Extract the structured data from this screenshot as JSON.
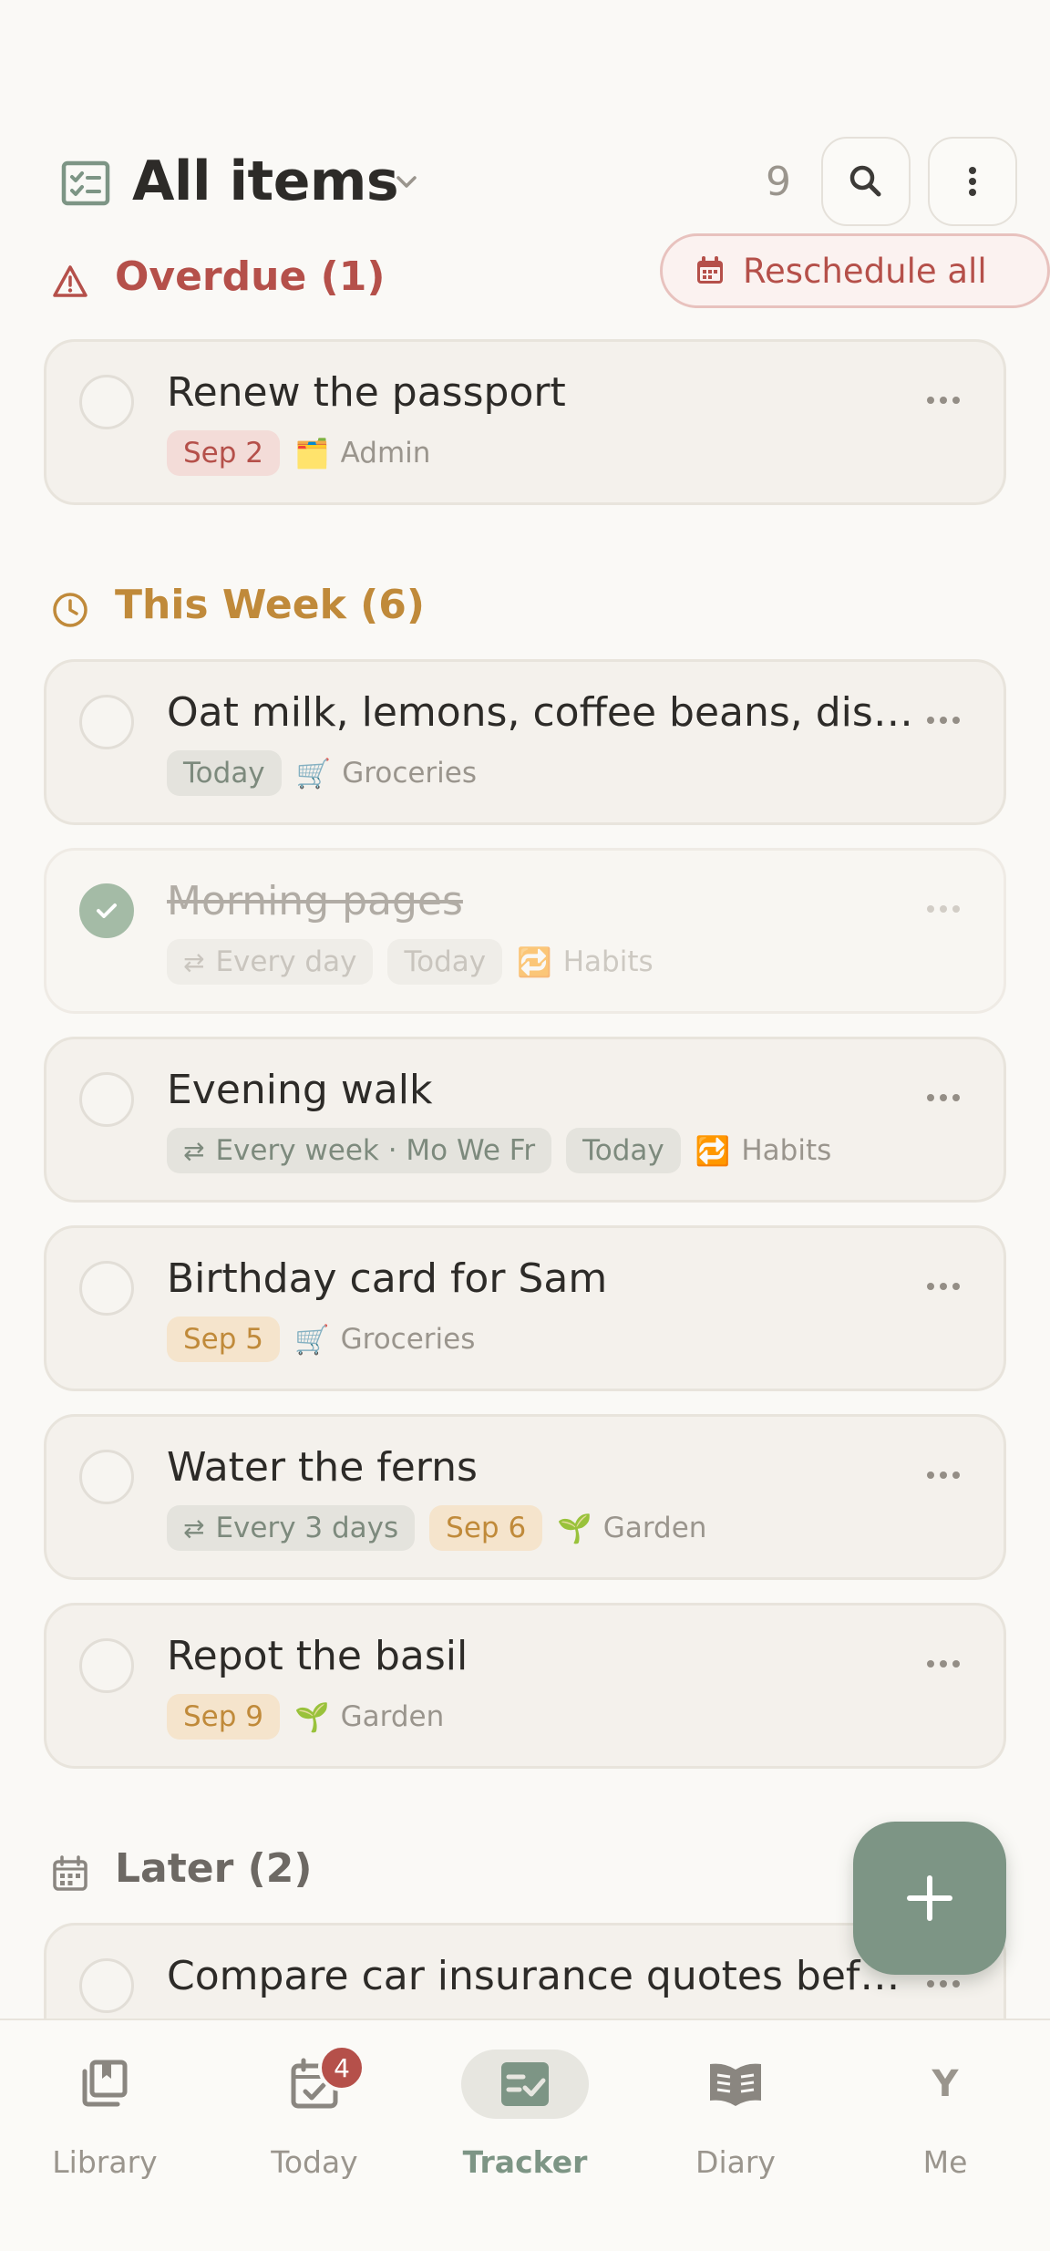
{
  "header": {
    "title": "All items",
    "count": "9",
    "icons": {
      "title": "checklist-icon",
      "chevron": "chevron-down-icon",
      "search": "search-icon",
      "more": "more-vertical-icon"
    }
  },
  "sections": {
    "overdue": {
      "title": "Overdue (1)",
      "action_label": "Reschedule all",
      "color": "#b5504a"
    },
    "this_week": {
      "title": "This Week (6)",
      "color": "#c08a3a"
    },
    "later": {
      "title": "Later (2)",
      "color": "#6d6964"
    }
  },
  "tasks": [
    {
      "title": "Renew the passport",
      "done": false,
      "date": "Sep 2",
      "list_icon": "🗂️",
      "list": "Admin"
    },
    {
      "title": "Oat milk, lemons, coffee beans, dish soap",
      "done": false,
      "date": "Today",
      "list_icon": "🛒",
      "list": "Groceries"
    },
    {
      "title": "Morning pages",
      "done": true,
      "repeat": "Every day",
      "date": "Today",
      "list_icon": "🔁",
      "list": "Habits"
    },
    {
      "title": "Evening walk",
      "done": false,
      "repeat": "Every week · Mo We Fr",
      "date": "Today",
      "list_icon": "🔁",
      "list": "Habits"
    },
    {
      "title": "Birthday card for Sam",
      "done": false,
      "date": "Sep 5",
      "list_icon": "🛒",
      "list": "Groceries"
    },
    {
      "title": "Water the ferns",
      "done": false,
      "repeat": "Every 3 days",
      "date": "Sep 6",
      "list_icon": "🌱",
      "list": "Garden"
    },
    {
      "title": "Repot the basil",
      "done": false,
      "date": "Sep 9",
      "list_icon": "🌱",
      "list": "Garden"
    },
    {
      "title": "Compare car insurance quotes before renewal",
      "done": false
    }
  ],
  "repeat_glyph": "⇄",
  "fab": {
    "icon": "plus-icon",
    "color": "#7d9585"
  },
  "nav": {
    "items": [
      {
        "label": "Library",
        "icon": "library-icon"
      },
      {
        "label": "Today",
        "icon": "calendar-check-icon",
        "badge": "4"
      },
      {
        "label": "Tracker",
        "icon": "tracker-icon",
        "active": true
      },
      {
        "label": "Diary",
        "icon": "book-open-icon"
      },
      {
        "label": "Me",
        "icon": "avatar",
        "initial": "Y"
      }
    ]
  },
  "colors": {
    "accent": "#7d9585",
    "danger": "#b5504a",
    "warning": "#c08a3a",
    "background": "#faf9f6"
  }
}
